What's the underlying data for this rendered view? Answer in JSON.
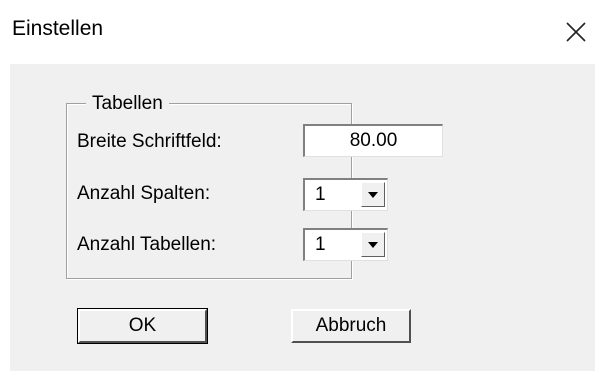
{
  "window": {
    "title": "Einstellen"
  },
  "group": {
    "title": "Tabellen",
    "rows": [
      {
        "label": "Breite Schriftfeld:",
        "value": "80.00"
      },
      {
        "label": "Anzahl Spalten:",
        "value": "1"
      },
      {
        "label": "Anzahl Tabellen:",
        "value": "1"
      }
    ]
  },
  "buttons": {
    "ok": "OK",
    "cancel": "Abbruch"
  },
  "icons": {
    "close": "close-icon",
    "dropdown": "chevron-down-icon"
  }
}
